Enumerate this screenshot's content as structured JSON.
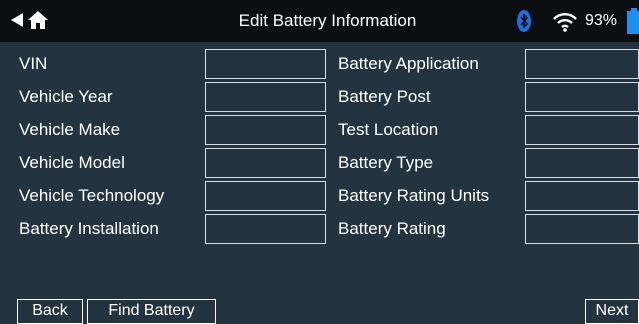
{
  "header": {
    "title": "Edit Battery Information",
    "battery_percent": "93%",
    "icons": [
      "back-arrow-icon",
      "home-icon",
      "bluetooth-icon",
      "wifi-icon",
      "battery-icon"
    ]
  },
  "left_column": [
    {
      "label": "VIN",
      "value": ""
    },
    {
      "label": "Vehicle Year",
      "value": ""
    },
    {
      "label": "Vehicle Make",
      "value": ""
    },
    {
      "label": "Vehicle Model",
      "value": ""
    },
    {
      "label": "Vehicle Technology",
      "value": ""
    },
    {
      "label": "Battery Installation",
      "value": ""
    }
  ],
  "right_column": [
    {
      "label": "Battery Application",
      "value": ""
    },
    {
      "label": "Battery Post",
      "value": ""
    },
    {
      "label": "Test Location",
      "value": ""
    },
    {
      "label": "Battery Type",
      "value": ""
    },
    {
      "label": "Battery Rating Units",
      "value": ""
    },
    {
      "label": "Battery Rating",
      "value": ""
    }
  ],
  "footer": {
    "back": "Back",
    "find_battery": "Find Battery",
    "next": "Next"
  },
  "colors": {
    "background": "#233440",
    "topbar": "#0b0f12",
    "bluetooth_accent": "#1f6fe0",
    "battery_accent": "#1e8ff0"
  }
}
